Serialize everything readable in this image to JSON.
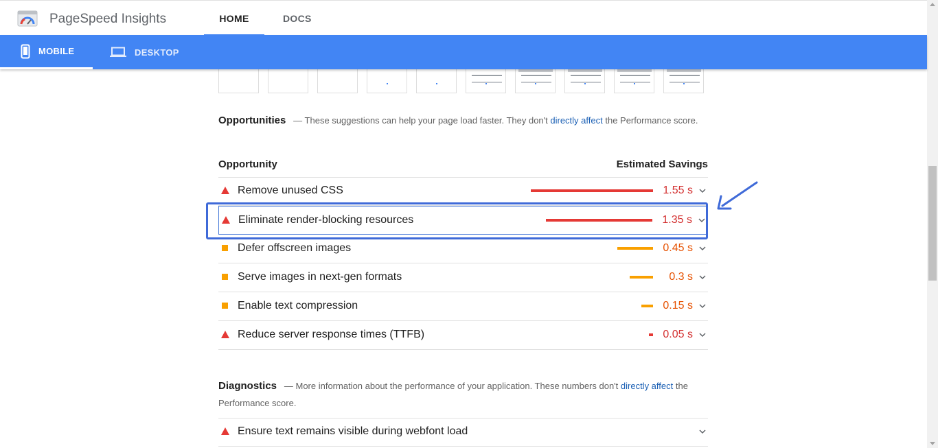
{
  "header": {
    "app_title": "PageSpeed Insights",
    "tabs": [
      {
        "label": "HOME",
        "active": true
      },
      {
        "label": "DOCS",
        "active": false
      }
    ]
  },
  "device_tabs": [
    {
      "label": "MOBILE",
      "active": true
    },
    {
      "label": "DESKTOP",
      "active": false
    }
  ],
  "opportunities": {
    "title": "Opportunities",
    "desc_before": "— These suggestions can help your page load faster. They don't ",
    "desc_link": "directly affect",
    "desc_after": " the Performance score.",
    "col_left": "Opportunity",
    "col_right": "Estimated Savings",
    "items": [
      {
        "label": "Remove unused CSS",
        "saving": "1.55 s",
        "seconds": 1.55,
        "severity": "fail",
        "highlighted": false
      },
      {
        "label": "Eliminate render-blocking resources",
        "saving": "1.35 s",
        "seconds": 1.35,
        "severity": "fail",
        "highlighted": true
      },
      {
        "label": "Defer offscreen images",
        "saving": "0.45 s",
        "seconds": 0.45,
        "severity": "average",
        "highlighted": false
      },
      {
        "label": "Serve images in next-gen formats",
        "saving": "0.3 s",
        "seconds": 0.3,
        "severity": "average",
        "highlighted": false
      },
      {
        "label": "Enable text compression",
        "saving": "0.15 s",
        "seconds": 0.15,
        "severity": "average",
        "highlighted": false
      },
      {
        "label": "Reduce server response times (TTFB)",
        "saving": "0.05 s",
        "seconds": 0.05,
        "severity": "fail",
        "highlighted": false
      }
    ]
  },
  "diagnostics": {
    "title": "Diagnostics",
    "desc_before": "— More information about the performance of your application. These numbers don't ",
    "desc_link": "directly affect",
    "desc_after": " the Performance score.",
    "items": [
      {
        "label": "Ensure text remains visible during webfont load",
        "severity": "fail"
      }
    ]
  },
  "colors": {
    "accent": "#4285f4",
    "fail": "#e53935",
    "average": "#f9a000",
    "highlight": "#3f6ad8",
    "link": "#1a5fb4"
  }
}
